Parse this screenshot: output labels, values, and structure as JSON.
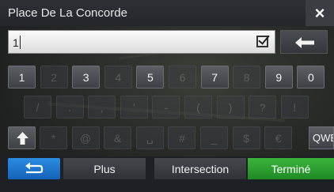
{
  "header": {
    "title": "Place De La Concorde",
    "close_label": "×"
  },
  "input": {
    "value": "1"
  },
  "keys": {
    "row1": [
      {
        "label": "1",
        "enabled": true
      },
      {
        "label": "2",
        "enabled": false
      },
      {
        "label": "3",
        "enabled": true
      },
      {
        "label": "4",
        "enabled": false
      },
      {
        "label": "5",
        "enabled": true
      },
      {
        "label": "6",
        "enabled": false
      },
      {
        "label": "7",
        "enabled": true
      },
      {
        "label": "8",
        "enabled": false
      },
      {
        "label": "9",
        "enabled": true
      },
      {
        "label": "0",
        "enabled": true
      }
    ],
    "row2": [
      {
        "label": "/",
        "enabled": false
      },
      {
        "label": ".",
        "enabled": false
      },
      {
        "label": ",",
        "enabled": false
      },
      {
        "label": "'",
        "enabled": false
      },
      {
        "label": "-",
        "enabled": false
      },
      {
        "label": "(",
        "enabled": false
      },
      {
        "label": ")",
        "enabled": false
      },
      {
        "label": "?",
        "enabled": false
      },
      {
        "label": "!",
        "enabled": false
      }
    ],
    "row3": [
      {
        "label": "*",
        "enabled": false
      },
      {
        "label": "@",
        "enabled": false
      },
      {
        "label": "&",
        "enabled": false
      },
      {
        "label": "␣",
        "enabled": false
      },
      {
        "label": "#",
        "enabled": false
      },
      {
        "label": "_",
        "enabled": false
      },
      {
        "label": "$",
        "enabled": false
      },
      {
        "label": "€",
        "enabled": false
      }
    ],
    "layout_switch_label": "QWE"
  },
  "footer": {
    "plus_label": "Plus",
    "intersection_label": "Intersection",
    "done_label": "Terminé"
  },
  "colors": {
    "done": "#2a9e2e",
    "back": "#1f78d1",
    "key": "#4a4e53"
  },
  "icons": {
    "shift": "shift-arrow-icon",
    "backspace": "left-arrow-icon",
    "back": "return-arrow-icon",
    "check": "checkbox-icon"
  }
}
